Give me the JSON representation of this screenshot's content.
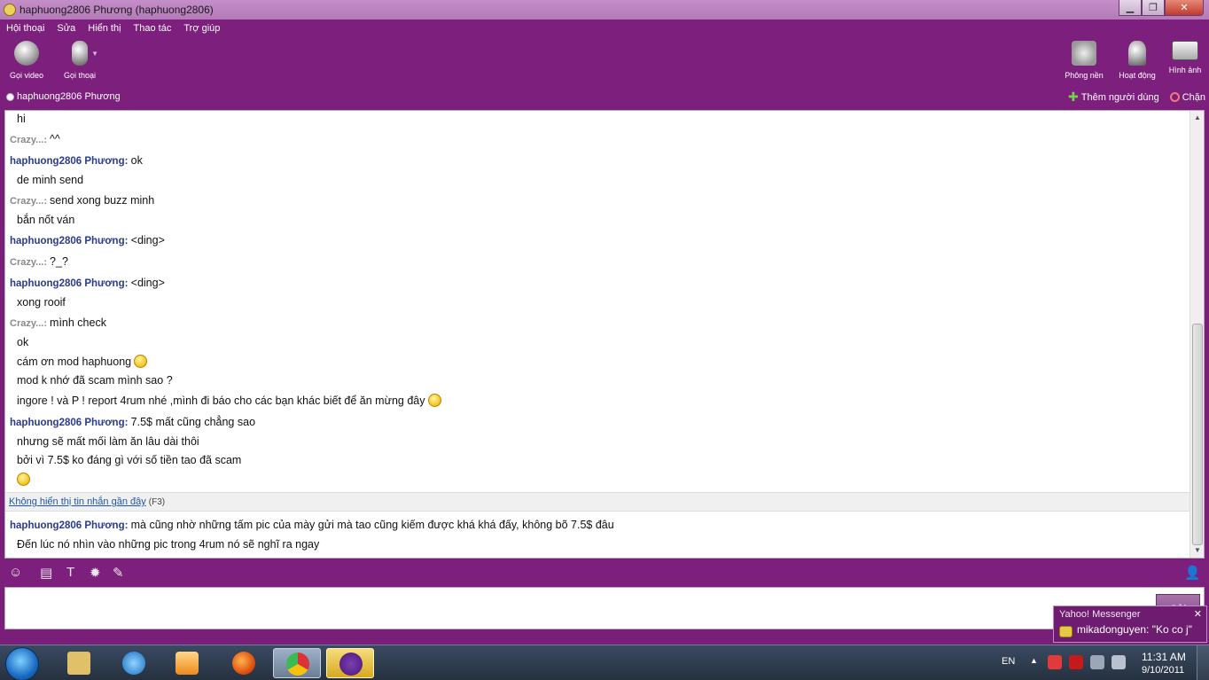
{
  "window": {
    "title": "haphuong2806 Phương (haphuong2806)",
    "minimize": "▁",
    "maximize": "❐",
    "close": "✕"
  },
  "menu": [
    "Hội thoại",
    "Sửa",
    "Hiển thị",
    "Thao tác",
    "Trợ giúp"
  ],
  "toolbar": {
    "video_call": "Gọi video",
    "voice_call": "Gọi thoại",
    "background": "Phông nền",
    "activities": "Hoạt động",
    "images": "Hình ảnh"
  },
  "contact": {
    "name": "haphuong2806 Phương",
    "add_user": "Thêm người dùng",
    "block": "Chặn"
  },
  "messages": [
    {
      "text": "hi"
    },
    {
      "sender": "Crazy...",
      "text": "^^"
    },
    {
      "sender": "haphuong2806 Phương",
      "text": "ok"
    },
    {
      "text": "de minh send"
    },
    {
      "sender": "Crazy...",
      "text": "send xong buzz minh"
    },
    {
      "text": "bắn nốt ván"
    },
    {
      "sender": "haphuong2806 Phương",
      "text": "<ding>"
    },
    {
      "sender": "Crazy...",
      "text": "?_?"
    },
    {
      "sender": "haphuong2806 Phương",
      "text": "<ding>"
    },
    {
      "text": "xong rooif"
    },
    {
      "sender": "Crazy...",
      "text": "mình check"
    },
    {
      "text": "ok"
    },
    {
      "text": "cám ơn mod haphuong"
    },
    {
      "text": "mod k nhớ đã scam mình sao ?"
    },
    {
      "text": "ingore ! và P ! report 4rum nhé ,mình đi báo cho các bạn khác biết để ăn mừng đây"
    },
    {
      "sender": "haphuong2806 Phương",
      "text": "7.5$ mất cũng chẳng sao"
    },
    {
      "text": "nhưng sẽ mất mối làm ăn lâu dài thôi"
    },
    {
      "text": "bởi vì 7.5$ ko đáng gì với số tiền tao đã scam"
    },
    {
      "sender": "haphuong2806 Phương",
      "text": "mà cũng nhờ những tấm pic của mày gửi mà tao cũng kiếm được khá khá đấy, không bõ 7.5$ đâu"
    },
    {
      "text": "Đến lúc nó nhìn vào những pic trong 4rum nó sẽ nghĩ ra ngay"
    }
  ],
  "recent": {
    "link": "Không hiển thị tin nhắn gần đây",
    "key": "(F3)"
  },
  "send_button": "Gửi",
  "notification": {
    "title": "Yahoo! Messenger",
    "message": "mikadonguyen: \"Ko co j\"",
    "close": "✕"
  },
  "taskbar": {
    "language": "EN",
    "time": "11:31 AM",
    "date": "9/10/2011"
  },
  "colors": {
    "chrome": "#7d1f7c",
    "me_sender": "#2a3b8f",
    "other_sender": "#8a8a8a"
  }
}
